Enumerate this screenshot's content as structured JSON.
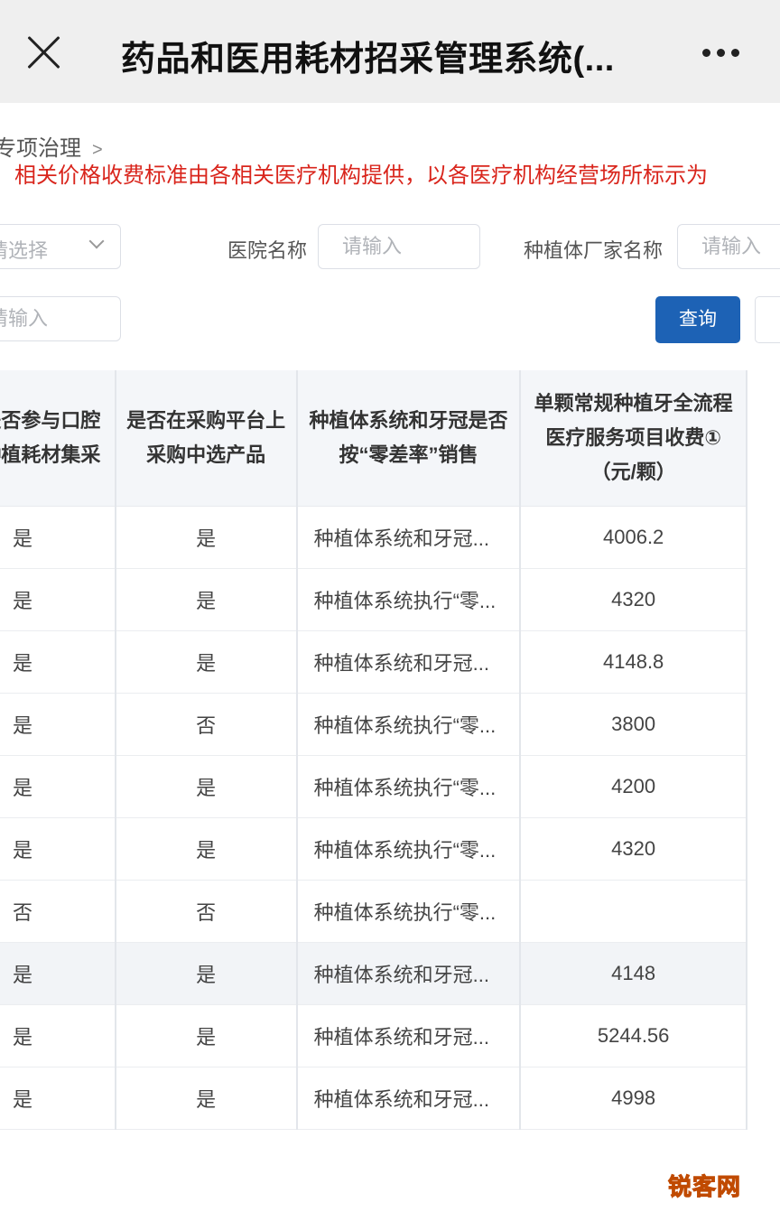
{
  "appbar": {
    "title": "药品和医用耗材招采管理系统(..."
  },
  "breadcrumb": {
    "text": "专项治理",
    "separator": ">"
  },
  "notice": "相关价格收费标准由各相关医疗机构提供，以各医疗机构经营场所标示为",
  "filters": {
    "select_placeholder": "请选择",
    "hospital_label": "医院名称",
    "hospital_placeholder": "请输入",
    "vendor_label": "种植体厂家名称",
    "vendor_placeholder": "请输入",
    "extra_placeholder": "请输入",
    "query_label": "查询"
  },
  "table": {
    "headers": [
      "是否参与口腔种植耗材集采",
      "是否在采购平台上采购中选产品",
      "种植体系统和牙冠是否按“零差率”销售",
      "单颗常规种植牙全流程医疗服务项目收费①（元/颗）"
    ],
    "rows": [
      [
        "是",
        "是",
        "种植体系统和牙冠...",
        "4006.2"
      ],
      [
        "是",
        "是",
        "种植体系统执行“零...",
        "4320"
      ],
      [
        "是",
        "是",
        "种植体系统和牙冠...",
        "4148.8"
      ],
      [
        "是",
        "否",
        "种植体系统执行“零...",
        "3800"
      ],
      [
        "是",
        "是",
        "种植体系统执行“零...",
        "4200"
      ],
      [
        "是",
        "是",
        "种植体系统执行“零...",
        "4320"
      ],
      [
        "否",
        "否",
        "种植体系统执行“零...",
        ""
      ],
      [
        "是",
        "是",
        "种植体系统和牙冠...",
        "4148"
      ],
      [
        "是",
        "是",
        "种植体系统和牙冠...",
        "5244.56"
      ],
      [
        "是",
        "是",
        "种植体系统和牙冠...",
        "4998"
      ]
    ]
  },
  "watermark": "锐客网",
  "colors": {
    "accent": "#1d62b5",
    "notice": "#d9251c"
  }
}
